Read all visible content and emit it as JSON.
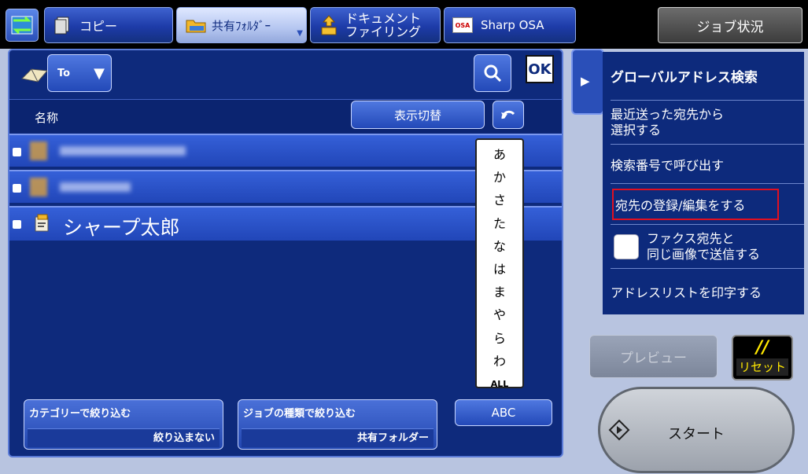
{
  "topbar": {
    "tabs": [
      {
        "label": "コピー",
        "icon": "copy-icon"
      },
      {
        "label": "共有ﾌｫﾙﾀﾞｰ",
        "icon": "folder-icon",
        "active": true
      },
      {
        "label1": "ドキュメント",
        "label2": "ファイリング",
        "icon": "document-filing-icon"
      },
      {
        "label": "Sharp OSA",
        "icon": "osa-icon",
        "icon_text": "OSA"
      }
    ],
    "job_status": "ジョブ状況"
  },
  "address": {
    "dest_type": "To",
    "ok_label": "OK",
    "column_name": "名称",
    "display_toggle": "表示切替",
    "entries": [
      {
        "name": "",
        "blurred": true
      },
      {
        "name": "",
        "blurred": true
      },
      {
        "name": "シャープ太郎",
        "blurred": false
      }
    ],
    "kana_index": [
      "あ",
      "か",
      "さ",
      "た",
      "な",
      "は",
      "ま",
      "や",
      "ら",
      "わ",
      "ALL"
    ]
  },
  "filters": {
    "category_label": "カテゴリーで絞り込む",
    "category_value": "絞り込まない",
    "jobtype_label": "ジョブの種類で絞り込む",
    "jobtype_value": "共有フォルダー",
    "abc_label": "ABC"
  },
  "side_menu": {
    "items": [
      {
        "label": "グローバルアドレス検索"
      },
      {
        "label1": "最近送った宛先から",
        "label2": "選択する"
      },
      {
        "label": "検索番号で呼び出す"
      },
      {
        "label": "宛先の登録/編集をする",
        "highlighted": true
      },
      {
        "label1": "ファクス宛先と",
        "label2": "同じ画像で送信する",
        "checkbox": true
      },
      {
        "label": "アドレスリストを印字する"
      }
    ]
  },
  "actions": {
    "preview": "プレビュー",
    "reset_symbol": "//",
    "reset_label": "リセット",
    "start": "スタート"
  },
  "colors": {
    "panel": "#0e2a7c",
    "row": "#2a50c8",
    "highlight_border": "#e01020",
    "reset_text": "#ffe800"
  }
}
